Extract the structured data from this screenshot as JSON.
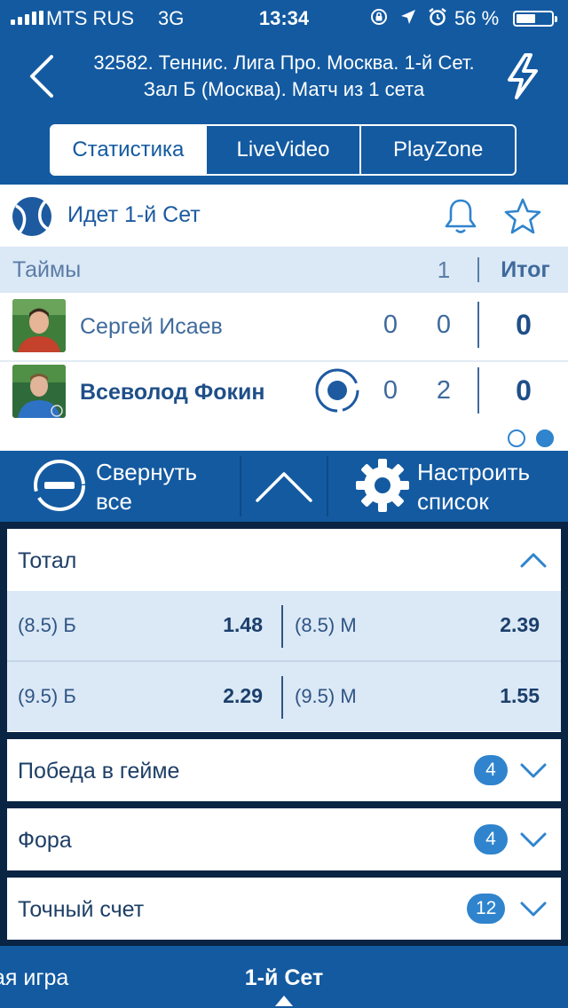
{
  "status_bar": {
    "carrier": "MTS RUS",
    "network": "3G",
    "time": "13:34",
    "battery_percent": "56 %",
    "battery_level": 0.56
  },
  "header": {
    "title": "32582. Теннис. Лига Про. Москва. 1-й Сет. Зал Б (Москва). Матч из 1 сета",
    "tabs": [
      "Статистика",
      "LiveVideo",
      "PlayZone"
    ],
    "active_tab": 0
  },
  "match": {
    "state": "Идет 1-й  Сет",
    "periods_label": "Таймы",
    "period_number": "1",
    "total_label": "Итог",
    "players": [
      {
        "name": "Сергей Исаев",
        "set_score": "0",
        "game_score": "0",
        "total": "0",
        "serving": false
      },
      {
        "name": "Всеволод Фокин",
        "set_score": "0",
        "game_score": "2",
        "total": "0",
        "serving": true
      }
    ],
    "pager_pages": 2,
    "pager_active": 1
  },
  "toolbar": {
    "collapse_label_line1": "Свернуть",
    "collapse_label_line2": "все",
    "settings_label_line1": "Настроить",
    "settings_label_line2": "список"
  },
  "markets": {
    "total": {
      "title": "Тотал",
      "rows": [
        {
          "over_label": "(8.5) Б",
          "over_odds": "1.48",
          "under_label": "(8.5) М",
          "under_odds": "2.39"
        },
        {
          "over_label": "(9.5) Б",
          "over_odds": "2.29",
          "under_label": "(9.5) М",
          "under_odds": "1.55"
        }
      ]
    },
    "collapsed": [
      {
        "title": "Победа в гейме",
        "count": "4"
      },
      {
        "title": "Фора",
        "count": "4"
      },
      {
        "title": "Точный счет",
        "count": "12"
      }
    ]
  },
  "bottom_bar": {
    "previous": "ая игра",
    "current": "1-й  Сет"
  },
  "colors": {
    "brand_blue": "#135aa1",
    "dark_bg": "#0a2444",
    "accent_blue": "#2f84cd",
    "light_row": "#dbe8f6"
  }
}
